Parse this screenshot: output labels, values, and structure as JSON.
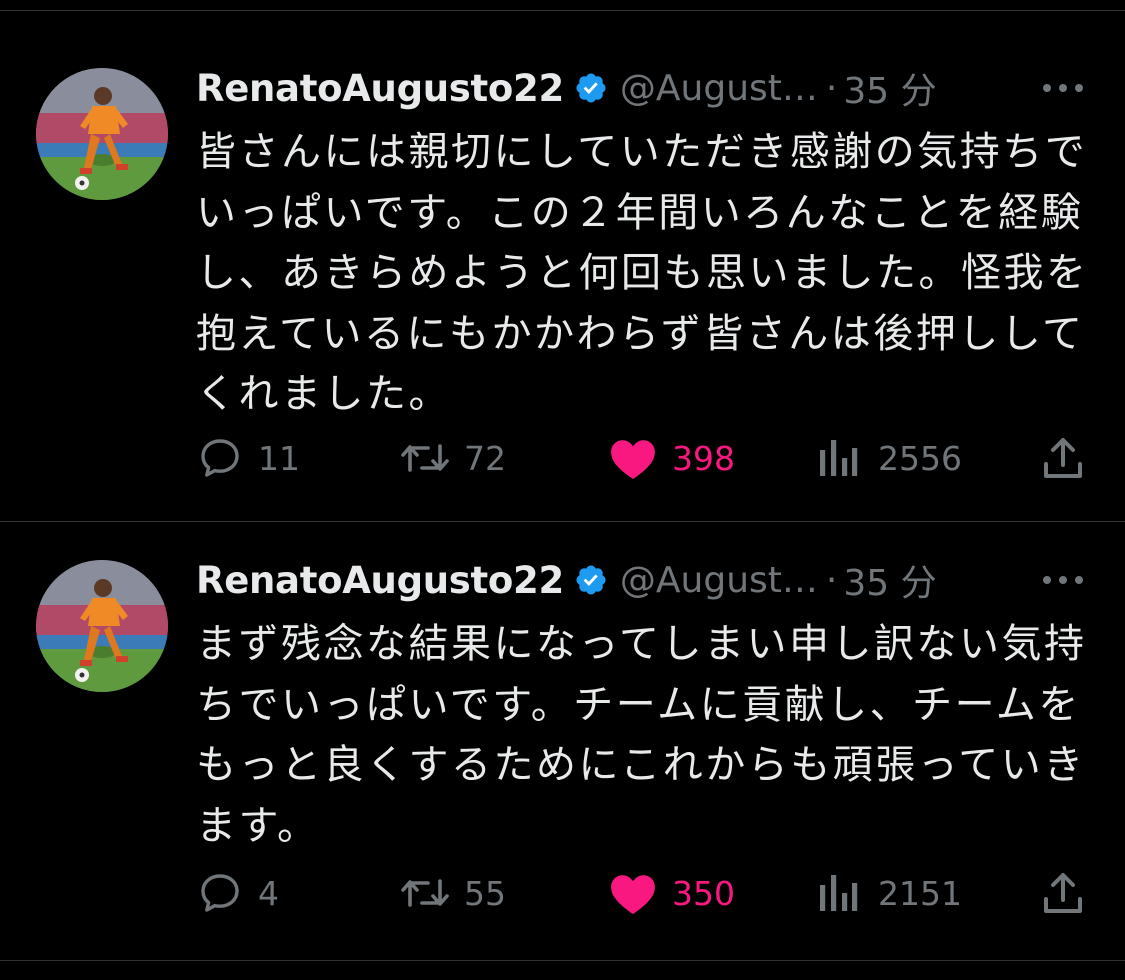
{
  "colors": {
    "background": "#000000",
    "text": "#e7e9ea",
    "muted": "#71767b",
    "like": "#f91880",
    "verified": "#1d9bf0"
  },
  "tweets": [
    {
      "display_name": "RenatoAugusto22",
      "handle": "@August…",
      "separator": "·",
      "time": "35 分",
      "avatar_icon": "player-avatar",
      "verified_icon": "verified-badge-icon",
      "text": "皆さんには親切にしていただき感謝の気持ちで\nいっぱいです。この２年間いろんなことを経験\nし、あきらめようと何回も思いました。怪我を\n抱えているにもかかわらず皆さんは後押しして\nくれました。",
      "replies": "11",
      "retweets": "72",
      "likes": "398",
      "views": "2556",
      "liked": true
    },
    {
      "display_name": "RenatoAugusto22",
      "handle": "@August…",
      "separator": "·",
      "time": "35 分",
      "avatar_icon": "player-avatar",
      "verified_icon": "verified-badge-icon",
      "text": "まず残念な結果になってしまい申し訳ない気持\nちでいっぱいです。チームに貢献し、チームを\nもっと良くするためにこれからも頑張っていき\nます。",
      "replies": "4",
      "retweets": "55",
      "likes": "350",
      "views": "2151",
      "liked": true
    }
  ]
}
